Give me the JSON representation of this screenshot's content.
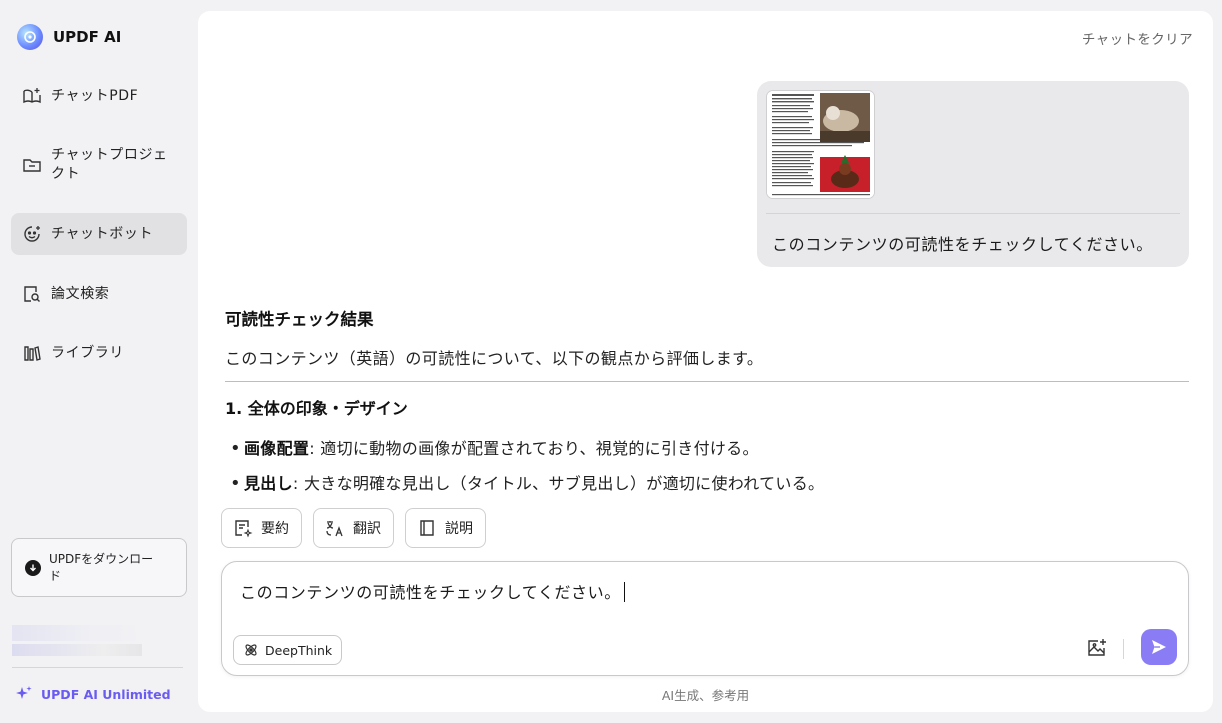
{
  "brand": {
    "name": "UPDF AI"
  },
  "sidebar": {
    "items": [
      {
        "label": "チャットPDF",
        "icon": "book-sparkle-icon"
      },
      {
        "label": "チャットプロジェクト",
        "icon": "folder-icon"
      },
      {
        "label": "チャットボット",
        "icon": "bot-face-icon",
        "active": true
      },
      {
        "label": "論文検索",
        "icon": "doc-search-icon"
      },
      {
        "label": "ライブラリ",
        "icon": "library-icon"
      }
    ],
    "download_label": "UPDFをダウンロード",
    "unlimited_label": "UPDF AI Unlimited"
  },
  "header": {
    "clear_label": "チャットをクリア"
  },
  "user_message": {
    "text": "このコンテンツの可読性をチェックしてください。"
  },
  "answer": {
    "title": "可読性チェック結果",
    "intro": "このコンテンツ（英語）の可読性について、以下の観点から評価します。",
    "section_title": "1. 全体の印象・デザイン",
    "bullets": [
      {
        "bold": "画像配置",
        "text": " : 適切に動物の画像が配置されており、視覚的に引き付ける。"
      },
      {
        "bold": "見出し",
        "text": " : 大きな明確な見出し（タイトル、サブ見出し）が適切に使われている。"
      }
    ]
  },
  "actions": {
    "summarize": "要約",
    "translate": "翻訳",
    "explain": "説明"
  },
  "composer": {
    "text": "このコンテンツの可読性をチェックしてください。",
    "deepthink_label": "DeepThink"
  },
  "footer": {
    "disclaimer": "AI生成、参考用"
  },
  "colors": {
    "accent": "#8a7cf5",
    "brand_purple": "#6a5cf0",
    "active_bg": "#e1e1e3"
  }
}
